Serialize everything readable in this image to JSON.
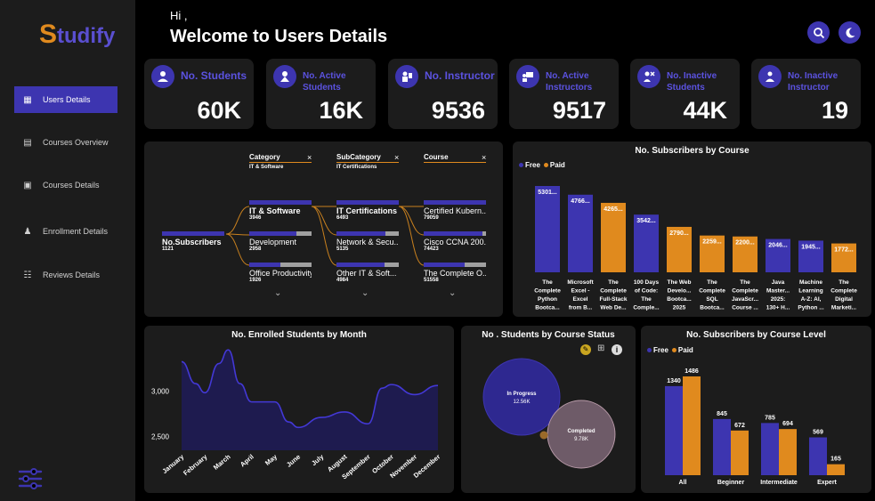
{
  "app": {
    "logo_s": "S",
    "logo_rest": "tudify"
  },
  "header": {
    "greeting": "Hi ,",
    "title": "Welcome to Users Details"
  },
  "nav": [
    {
      "label": "Users Details",
      "icon": "users-details-icon",
      "active": true
    },
    {
      "label": "Courses Overview",
      "icon": "courses-overview-icon",
      "active": false
    },
    {
      "label": "Courses Details",
      "icon": "courses-details-icon",
      "active": false
    },
    {
      "label": "Enrollment Details",
      "icon": "enrollment-icon",
      "active": false
    },
    {
      "label": "Reviews Details",
      "icon": "reviews-icon",
      "active": false
    }
  ],
  "kpis": [
    {
      "label": "No. Students",
      "value": "60K",
      "icon": "student-icon"
    },
    {
      "label": "No. Active Students",
      "value": "16K",
      "icon": "active-student-icon"
    },
    {
      "label": "No. Instructor",
      "value": "9536",
      "icon": "instructor-icon"
    },
    {
      "label": "No. Active Instructors",
      "value": "9517",
      "icon": "active-instructor-icon"
    },
    {
      "label": "No. Inactive Students",
      "value": "44K",
      "icon": "inactive-student-icon"
    },
    {
      "label": "No. Inactive Instructor",
      "value": "19",
      "icon": "inactive-instructor-icon"
    }
  ],
  "colors": {
    "accent": "#3d35b0",
    "free": "#3d35b0",
    "paid": "#e08a1e",
    "panel": "#1c1c1c"
  },
  "tree": {
    "root": {
      "label": "No.Subscribers",
      "value": "1121"
    },
    "headers": [
      {
        "label": "Category",
        "sub": "IT & Software"
      },
      {
        "label": "SubCategory",
        "sub": "IT Certifications"
      },
      {
        "label": "Course",
        "sub": ""
      }
    ],
    "close_glyph": "×",
    "levels": [
      [
        {
          "label": "IT & Software",
          "value": "3946",
          "bold": true,
          "fill": 1.0
        },
        {
          "label": "Development",
          "value": "2958",
          "bold": false,
          "fill": 0.75
        },
        {
          "label": "Office Productivity",
          "value": "1926",
          "bold": false,
          "fill": 0.5
        }
      ],
      [
        {
          "label": "IT Certifications",
          "value": "6493",
          "bold": true,
          "fill": 1.0
        },
        {
          "label": "Network & Secu...",
          "value": "5135",
          "bold": false,
          "fill": 0.79
        },
        {
          "label": "Other IT & Soft...",
          "value": "4984",
          "bold": false,
          "fill": 0.77
        }
      ],
      [
        {
          "label": "Certified Kubern...",
          "value": "79059",
          "bold": false,
          "fill": 1.0
        },
        {
          "label": "Cisco CCNA 200...",
          "value": "74423",
          "bold": false,
          "fill": 0.94
        },
        {
          "label": "The Complete O...",
          "value": "51558",
          "bold": false,
          "fill": 0.65
        }
      ]
    ]
  },
  "chart_data": [
    {
      "type": "bar",
      "title": "No. Subscribers by Course",
      "legend": [
        "Free",
        "Paid"
      ],
      "legend_placement": "top-left",
      "categories": [
        [
          "The",
          "Complete",
          "Python",
          "Bootca..."
        ],
        [
          "Microsoft",
          "Excel -",
          "Excel",
          "from B..."
        ],
        [
          "The",
          "Complete",
          "Full-Stack",
          "Web De..."
        ],
        [
          "100 Days",
          "of Code:",
          "The",
          "Comple..."
        ],
        [
          "The Web",
          "Develo...",
          "Bootca...",
          "2025"
        ],
        [
          "The",
          "Complete",
          "SQL",
          "Bootca..."
        ],
        [
          "The",
          "Complete",
          "JavaScr...",
          "Course ..."
        ],
        [
          "Java",
          "Master...",
          "2025:",
          "130+ H..."
        ],
        [
          "Machine",
          "Learning",
          "A-Z: AI,",
          "Python ..."
        ],
        [
          "The",
          "Complete",
          "Digital",
          "Marketi..."
        ]
      ],
      "values": [
        5301,
        4766,
        4265,
        3542,
        2790,
        2259,
        2200,
        2046,
        1945,
        1772
      ],
      "labels": [
        "5301...",
        "4766...",
        "4265...",
        "3542...",
        "2790...",
        "2259...",
        "2200...",
        "2046...",
        "1945...",
        "1772..."
      ],
      "types": [
        "Free",
        "Free",
        "Paid",
        "Free",
        "Paid",
        "Paid",
        "Paid",
        "Free",
        "Free",
        "Paid"
      ],
      "ylim": [
        0,
        5500
      ]
    },
    {
      "type": "area",
      "title": "No. Enrolled Students by Month",
      "categories": [
        "January",
        "February",
        "March",
        "April",
        "May",
        "June",
        "July",
        "August",
        "September",
        "October",
        "November",
        "December"
      ],
      "points": [
        {
          "x": 0,
          "y": 3320
        },
        {
          "x": 0.6,
          "y": 3080
        },
        {
          "x": 1,
          "y": 2980
        },
        {
          "x": 1.6,
          "y": 3300
        },
        {
          "x": 2,
          "y": 3450
        },
        {
          "x": 2.5,
          "y": 3080
        },
        {
          "x": 3,
          "y": 2880
        },
        {
          "x": 4,
          "y": 2880
        },
        {
          "x": 4.6,
          "y": 2660
        },
        {
          "x": 5,
          "y": 2600
        },
        {
          "x": 6,
          "y": 2710
        },
        {
          "x": 7,
          "y": 2770
        },
        {
          "x": 8,
          "y": 2640
        },
        {
          "x": 8.6,
          "y": 3030
        },
        {
          "x": 9,
          "y": 3070
        },
        {
          "x": 10,
          "y": 2960
        },
        {
          "x": 11,
          "y": 3060
        }
      ],
      "yticks": [
        "3,000",
        "2,500"
      ],
      "ytick_values": [
        3000,
        2500
      ],
      "ylim": [
        2350,
        3500
      ]
    },
    {
      "type": "scatter",
      "title": "No . Students by Course Status",
      "bubbles": [
        {
          "label": "In Progress",
          "value": "12.56K",
          "size": 12.56,
          "color": "#2e2890"
        },
        {
          "label": "Completed",
          "value": "9.78K",
          "size": 9.78,
          "color": "#6e5b68"
        }
      ]
    },
    {
      "type": "bar",
      "title": "No. Subscribers by Course Level",
      "legend": [
        "Free",
        "Paid"
      ],
      "legend_placement": "top-left",
      "categories": [
        "All",
        "Beginner",
        "Intermediate",
        "Expert"
      ],
      "series": [
        {
          "name": "Free",
          "values": [
            1340,
            845,
            785,
            569
          ]
        },
        {
          "name": "Paid",
          "values": [
            1486,
            672,
            694,
            165
          ]
        }
      ],
      "ylim": [
        0,
        1600
      ]
    }
  ]
}
